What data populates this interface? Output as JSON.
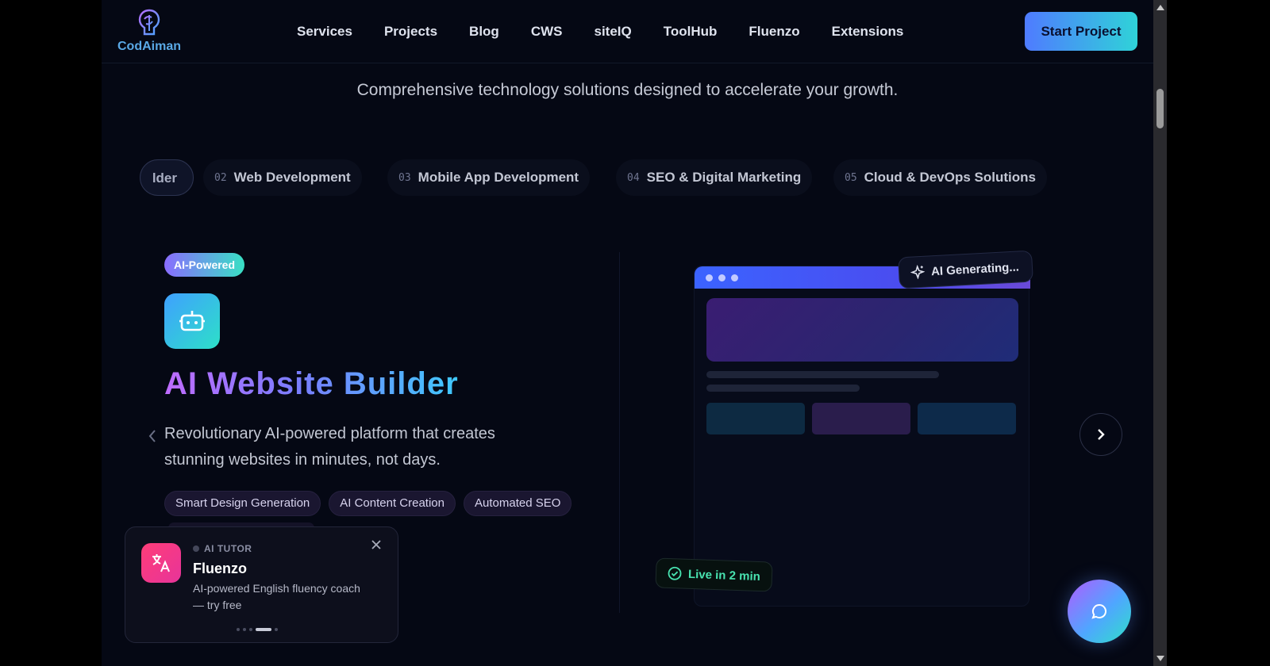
{
  "header": {
    "logo_text": "CodAiman",
    "nav": [
      "Services",
      "Projects",
      "Blog",
      "CWS",
      "siteIQ",
      "ToolHub",
      "Fluenzo",
      "Extensions"
    ],
    "cta_label": "Start Project"
  },
  "section": {
    "subtitle": "Comprehensive technology solutions designed to accelerate your growth."
  },
  "service_tabs": {
    "partial_label": "lder",
    "items": [
      {
        "num": "02",
        "label": "Web Development"
      },
      {
        "num": "03",
        "label": "Mobile App Development"
      },
      {
        "num": "04",
        "label": "SEO & Digital Marketing"
      },
      {
        "num": "05",
        "label": "Cloud & DevOps Solutions"
      }
    ]
  },
  "slide": {
    "badge": "AI-Powered",
    "icon": "robot-icon",
    "title": "AI Website Builder",
    "description": "Revolutionary AI-powered platform that creates stunning websites in minutes, not days.",
    "features": [
      "Smart Design Generation",
      "AI Content Creation",
      "Automated SEO"
    ],
    "mockup": {
      "ai_status": "AI Generating...",
      "live_label": "Live in 2 min"
    }
  },
  "toast": {
    "kicker": "AI TUTOR",
    "title": "Fluenzo",
    "description": "AI-powered English fluency coach — try free",
    "icon": "translate-icon",
    "pages": 5,
    "active_page": 4
  },
  "colors": {
    "background": "#050814",
    "accent_gradient_start": "#4f7bff",
    "accent_gradient_end": "#2fd3d8",
    "toast_icon": "#ff3d78",
    "live_green": "#48e3b0"
  }
}
